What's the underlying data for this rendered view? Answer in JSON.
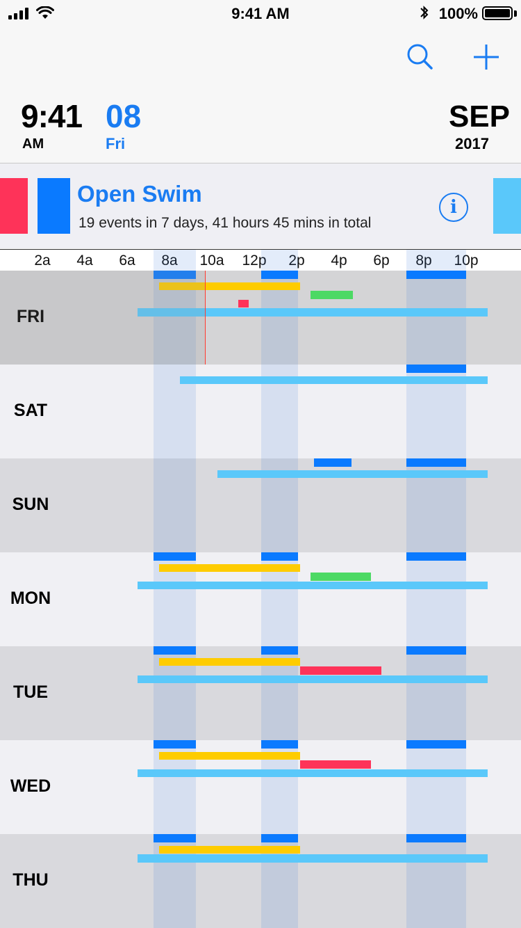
{
  "status_bar": {
    "time": "9:41 AM",
    "battery_percent": "100%",
    "battery_level": 1.0,
    "icons": [
      "signal-icon",
      "wifi-icon",
      "bluetooth-icon",
      "battery-icon"
    ]
  },
  "header": {
    "search_icon": "search-icon",
    "add_icon": "plus-icon",
    "time": "9:41",
    "ampm": "AM",
    "day_number": "08",
    "weekday": "Fri",
    "month": "SEP",
    "year": "2017"
  },
  "event": {
    "title": "Open Swim",
    "summary": "19 events in 7 days, 41 hours 45 mins in total",
    "info_icon": "info-icon",
    "swatch_colors": [
      "#fe3359",
      "#0a7aff",
      "#5ac8fa"
    ]
  },
  "colors": {
    "accent": "#1a7cf2",
    "yellow": "#fecc00",
    "green": "#4cd964",
    "red": "#fe3359",
    "blue": "#0a7aff",
    "lightblue": "#5ac8fa",
    "now_line": "#ff3b30"
  },
  "timeline": {
    "ticks": [
      "2a",
      "4a",
      "6a",
      "8a",
      "10a",
      "12p",
      "2p",
      "4p",
      "6p",
      "8p",
      "10p"
    ],
    "highlight_hours": [
      [
        7.25,
        9.25
      ],
      [
        12.33,
        14.08
      ],
      [
        19.17,
        22.0
      ]
    ],
    "now_hour": 9.68,
    "days": [
      {
        "label": "FRI",
        "today": true,
        "events": [
          {
            "color": "blue",
            "start": 7.25,
            "end": 9.25,
            "lane": 0
          },
          {
            "color": "blue",
            "start": 12.33,
            "end": 14.08,
            "lane": 0
          },
          {
            "color": "blue",
            "start": 19.17,
            "end": 22.0,
            "lane": 0
          },
          {
            "color": "yellow",
            "start": 7.5,
            "end": 14.17,
            "lane": 1
          },
          {
            "color": "green",
            "start": 14.67,
            "end": 16.67,
            "lane": 2
          },
          {
            "color": "red",
            "start": 11.25,
            "end": 11.75,
            "lane": 3
          },
          {
            "color": "lightblue",
            "start": 6.5,
            "end": 23.0,
            "lane": 4
          }
        ]
      },
      {
        "label": "SAT",
        "today": false,
        "events": [
          {
            "color": "blue",
            "start": 19.17,
            "end": 22.0,
            "lane": 0
          },
          {
            "color": "lightblue",
            "start": 8.5,
            "end": 23.0,
            "lane": 1
          }
        ]
      },
      {
        "label": "SUN",
        "today": false,
        "events": [
          {
            "color": "blue",
            "start": 14.83,
            "end": 16.58,
            "lane": 0
          },
          {
            "color": "blue",
            "start": 19.17,
            "end": 22.0,
            "lane": 0
          },
          {
            "color": "lightblue",
            "start": 10.25,
            "end": 23.0,
            "lane": 1
          }
        ]
      },
      {
        "label": "MON",
        "today": false,
        "events": [
          {
            "color": "blue",
            "start": 7.25,
            "end": 9.25,
            "lane": 0
          },
          {
            "color": "blue",
            "start": 12.33,
            "end": 14.08,
            "lane": 0
          },
          {
            "color": "blue",
            "start": 19.17,
            "end": 22.0,
            "lane": 0
          },
          {
            "color": "yellow",
            "start": 7.5,
            "end": 14.17,
            "lane": 1
          },
          {
            "color": "green",
            "start": 14.67,
            "end": 17.5,
            "lane": 2
          },
          {
            "color": "lightblue",
            "start": 6.5,
            "end": 23.0,
            "lane": 3
          }
        ]
      },
      {
        "label": "TUE",
        "today": false,
        "events": [
          {
            "color": "blue",
            "start": 7.25,
            "end": 9.25,
            "lane": 0
          },
          {
            "color": "blue",
            "start": 12.33,
            "end": 14.08,
            "lane": 0
          },
          {
            "color": "blue",
            "start": 19.17,
            "end": 22.0,
            "lane": 0
          },
          {
            "color": "yellow",
            "start": 7.5,
            "end": 14.17,
            "lane": 1
          },
          {
            "color": "red",
            "start": 14.17,
            "end": 18.0,
            "lane": 2
          },
          {
            "color": "lightblue",
            "start": 6.5,
            "end": 23.0,
            "lane": 3
          }
        ]
      },
      {
        "label": "WED",
        "today": false,
        "events": [
          {
            "color": "blue",
            "start": 7.25,
            "end": 9.25,
            "lane": 0
          },
          {
            "color": "blue",
            "start": 12.33,
            "end": 14.08,
            "lane": 0
          },
          {
            "color": "blue",
            "start": 19.17,
            "end": 22.0,
            "lane": 0
          },
          {
            "color": "yellow",
            "start": 7.5,
            "end": 14.17,
            "lane": 1
          },
          {
            "color": "red",
            "start": 14.17,
            "end": 17.5,
            "lane": 2
          },
          {
            "color": "lightblue",
            "start": 6.5,
            "end": 23.0,
            "lane": 3
          }
        ]
      },
      {
        "label": "THU",
        "today": false,
        "events": [
          {
            "color": "blue",
            "start": 7.25,
            "end": 9.25,
            "lane": 0
          },
          {
            "color": "blue",
            "start": 12.33,
            "end": 14.08,
            "lane": 0
          },
          {
            "color": "blue",
            "start": 19.17,
            "end": 22.0,
            "lane": 0
          },
          {
            "color": "yellow",
            "start": 7.5,
            "end": 14.17,
            "lane": 1
          },
          {
            "color": "lightblue",
            "start": 6.5,
            "end": 23.0,
            "lane": 2
          }
        ]
      }
    ]
  }
}
